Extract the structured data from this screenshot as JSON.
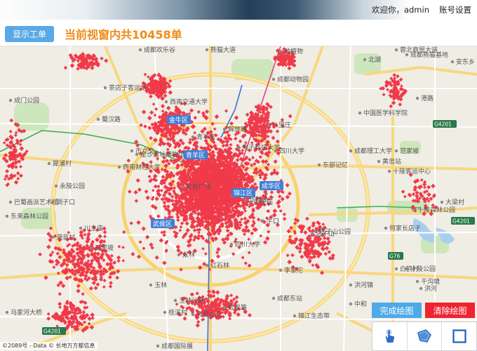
{
  "header": {
    "welcome": "欢迎你，admin",
    "account_settings": "账号设置"
  },
  "toolbar": {
    "show_orders_label": "显示工单",
    "order_count_text": "当前视窗内共10458单"
  },
  "map": {
    "attribution": "©2089号 - Data © 长地万方都信息",
    "labels": [
      {
        "name": "成都欢乐谷"
      },
      {
        "name": "熊猫大道"
      },
      {
        "name": "动植物"
      },
      {
        "name": "北湖"
      },
      {
        "name": "成都熊猫基地"
      },
      {
        "name": "安东乡"
      },
      {
        "name": "蓉北商贸大道"
      },
      {
        "name": "茶店子客运站"
      },
      {
        "name": "西南交通大学"
      },
      {
        "name": "成都动物园"
      },
      {
        "name": "成门公园"
      },
      {
        "name": "蜀汉路"
      },
      {
        "name": "解放路"
      },
      {
        "name": "八里庄"
      },
      {
        "name": "中国医学科学院"
      },
      {
        "name": "港路"
      },
      {
        "name": "市立交"
      },
      {
        "name": "青羊宫"
      },
      {
        "name": "四川大学"
      },
      {
        "name": "电子科技大学"
      },
      {
        "name": "成都理工大学"
      },
      {
        "name": "范家坡"
      },
      {
        "name": "东部记忆"
      },
      {
        "name": "黄忠站"
      },
      {
        "name": "十陵客运中心"
      },
      {
        "name": "犀浦村"
      },
      {
        "name": "西南财经大学"
      },
      {
        "name": "金沙遗址博物馆"
      },
      {
        "name": "永陵公园"
      },
      {
        "name": "巴蜀画派艺术馆"
      },
      {
        "name": "洞子口"
      },
      {
        "name": "东来森林公园"
      },
      {
        "name": "天府广场"
      },
      {
        "name": "牛王庙"
      },
      {
        "name": "十陵森林公园"
      },
      {
        "name": "大梁村"
      },
      {
        "name": "何家长店子"
      },
      {
        "name": "潮音村"
      },
      {
        "name": "牛口"
      },
      {
        "name": "塔子山公园"
      },
      {
        "name": "川主庙"
      },
      {
        "name": "华西坝"
      },
      {
        "name": "四川大学"
      },
      {
        "name": "双林"
      },
      {
        "name": "白鹤村"
      },
      {
        "name": "红石林"
      },
      {
        "name": "玉林"
      },
      {
        "name": "李家沱"
      },
      {
        "name": "洪河镇"
      },
      {
        "name": "十陵公园"
      },
      {
        "name": "马家河大桥"
      },
      {
        "name": "桂溪村"
      },
      {
        "name": "成都东站"
      },
      {
        "name": "玉林公园"
      },
      {
        "name": "塔子山"
      },
      {
        "name": "天府立交"
      },
      {
        "name": "锦江生态带"
      },
      {
        "name": "中和"
      },
      {
        "name": "成都国际展"
      },
      {
        "name": "红星路"
      },
      {
        "name": "洪河"
      },
      {
        "name": "干沟塘"
      },
      {
        "name": "五里坡"
      }
    ],
    "district_tags": [
      "金牛区",
      "青羊区",
      "锦江区",
      "成华区",
      "武侯区"
    ],
    "highway_shields": [
      "G4201",
      "G4201",
      "G4201",
      "G4201",
      "G76"
    ],
    "order_color": "#f03a4a"
  },
  "actions": {
    "finish_drawing": "完成绘图",
    "clear_drawing": "清除绘图"
  },
  "draw_tools": {
    "items": [
      "hand-icon",
      "polygon-icon",
      "rectangle-icon"
    ]
  }
}
